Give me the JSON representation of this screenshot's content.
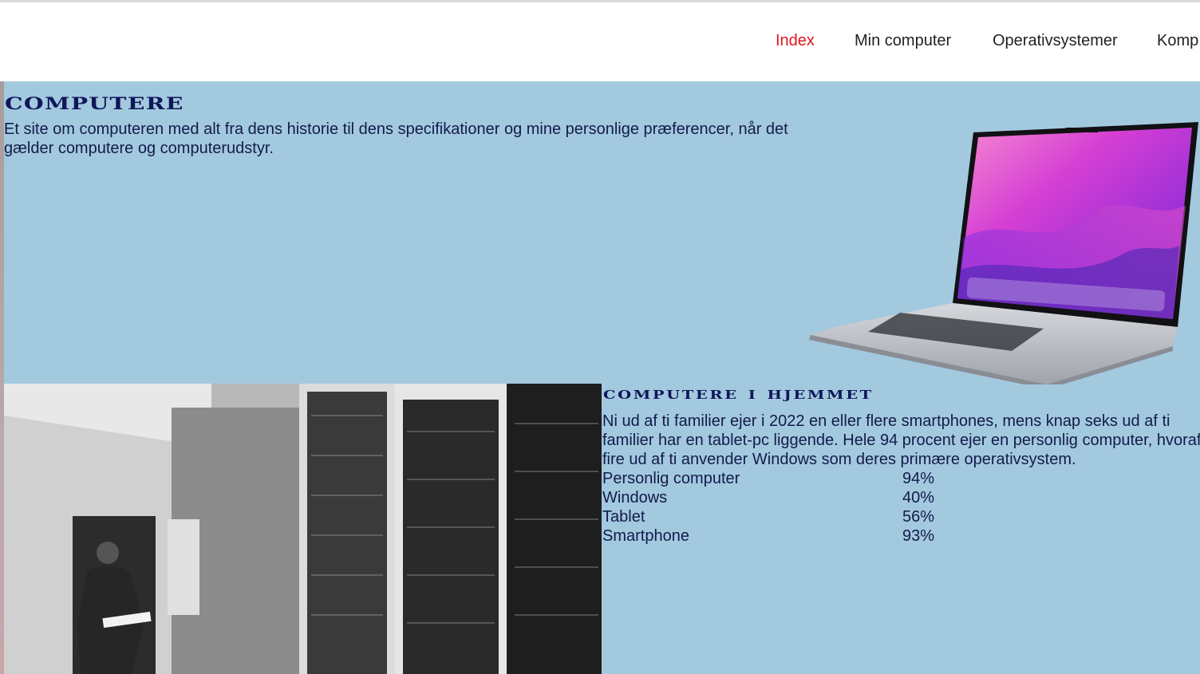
{
  "nav": {
    "items": [
      {
        "label": "Index",
        "active": true
      },
      {
        "label": "Min computer",
        "active": false
      },
      {
        "label": "Operativsystemer",
        "active": false
      },
      {
        "label": "Komp",
        "active": false
      }
    ]
  },
  "hero": {
    "title": "Computere",
    "text": "Et site om computeren med alt fra dens historie til dens specifikationer og mine personlige præferencer, når det gælder computere og computerudstyr."
  },
  "section": {
    "title": "Computere i hjemmet",
    "text": "Ni ud af ti familier ejer i 2022 en eller flere smartphones, mens knap seks ud af ti familier har en tablet-pc liggende. Hele 94 procent ejer en personlig computer, hvoraf fire ud af ti anvender Windows som deres primære operativsystem.",
    "stats": [
      {
        "label": "Personlig computer",
        "value": "94%"
      },
      {
        "label": "Windows",
        "value": "40%"
      },
      {
        "label": "Tablet",
        "value": "56%"
      },
      {
        "label": "Smartphone",
        "value": "93%"
      }
    ]
  },
  "colors": {
    "background": "#a3c9df",
    "heading": "#0f1659",
    "nav_active": "#e0161a"
  }
}
